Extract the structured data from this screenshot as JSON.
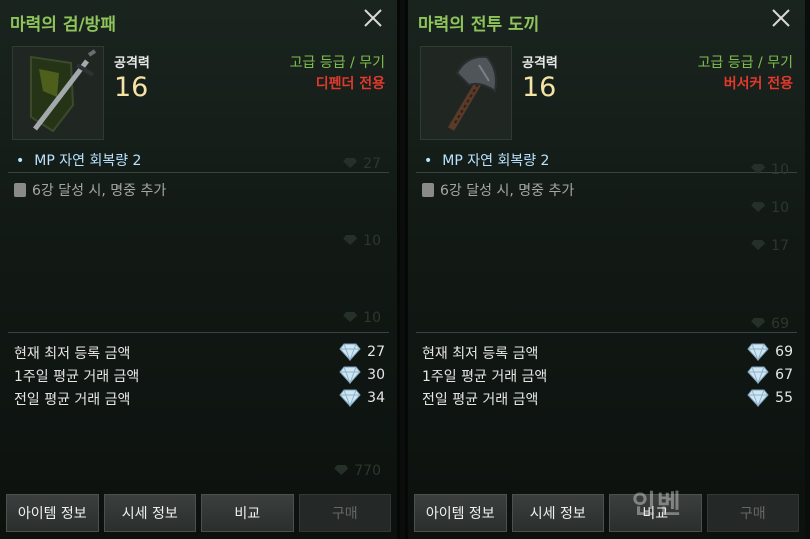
{
  "panels": [
    {
      "title": "마력의 검/방패",
      "stat_label": "공격력",
      "stat_value": "16",
      "grade": "고급 등급 / 무기",
      "class_req": "디펜더 전용",
      "option": "MP 자연 회복량 2",
      "enhance_note": "6강 달성 시, 명중 추가",
      "bg_numbers": [
        "27",
        "10",
        "10",
        "770"
      ],
      "prices": [
        {
          "label": "현재 최저 등록 금액",
          "value": "27"
        },
        {
          "label": "1주일 평균 거래 금액",
          "value": "30"
        },
        {
          "label": "전일 평균 거래 금액",
          "value": "34"
        }
      ],
      "icon": "sword-shield-icon"
    },
    {
      "title": "마력의 전투 도끼",
      "stat_label": "공격력",
      "stat_value": "16",
      "grade": "고급 등급 / 무기",
      "class_req": "버서커 전용",
      "option": "MP 자연 회복량 2",
      "enhance_note": "6강 달성 시, 명중 추가",
      "bg_numbers": [
        "10",
        "10",
        "17",
        "69"
      ],
      "prices": [
        {
          "label": "현재 최저 등록 금액",
          "value": "69"
        },
        {
          "label": "1주일 평균 거래 금액",
          "value": "67"
        },
        {
          "label": "전일 평균 거래 금액",
          "value": "55"
        }
      ],
      "icon": "battle-axe-icon"
    }
  ],
  "buttons": {
    "item_info": "아이템 정보",
    "market_info": "시세 정보",
    "compare": "비교",
    "buy": "구매"
  },
  "watermark": "인벤"
}
